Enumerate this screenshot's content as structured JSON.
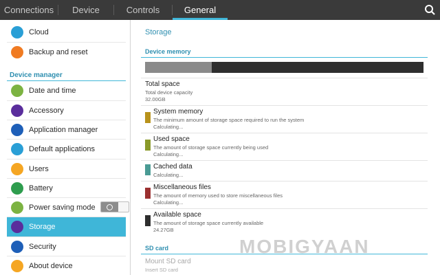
{
  "tabs": [
    {
      "label": "Connections"
    },
    {
      "label": "Device"
    },
    {
      "label": "Controls"
    },
    {
      "label": "General"
    }
  ],
  "search_icon": "search-icon",
  "sidebar": {
    "section_header": "Device manager",
    "items": [
      {
        "label": "Cloud",
        "icon": "cloud-icon",
        "color": "#2a9fd6"
      },
      {
        "label": "Backup and reset",
        "icon": "backup-icon",
        "color": "#f07b22"
      },
      {
        "label": "Date and time",
        "icon": "clock-icon",
        "color": "#7cb342"
      },
      {
        "label": "Accessory",
        "icon": "accessory-icon",
        "color": "#5a2d9c"
      },
      {
        "label": "Application manager",
        "icon": "grid-icon",
        "color": "#1e5fb8"
      },
      {
        "label": "Default applications",
        "icon": "apps-icon",
        "color": "#2a9fd6"
      },
      {
        "label": "Users",
        "icon": "user-icon",
        "color": "#f5a623"
      },
      {
        "label": "Battery",
        "icon": "battery-icon",
        "color": "#2e9d4e"
      },
      {
        "label": "Power saving mode",
        "icon": "leaf-icon",
        "color": "#7cb342"
      },
      {
        "label": "Storage",
        "icon": "storage-icon",
        "color": "#5a2d9c"
      },
      {
        "label": "Security",
        "icon": "lock-icon",
        "color": "#1e5fb8"
      },
      {
        "label": "About device",
        "icon": "info-icon",
        "color": "#f5a623"
      }
    ],
    "power_saving_enabled": false,
    "active_color": "#3fb6d8"
  },
  "content": {
    "title": "Storage",
    "device_memory": {
      "header": "Device memory",
      "used_fraction": 0.24,
      "total": {
        "title": "Total space",
        "sub": "Total device capacity",
        "value": "32.00GB"
      },
      "rows": [
        {
          "title": "System memory",
          "desc": "The minimum amount of storage space required to run the system",
          "value": "Calculating...",
          "color": "#b8921c"
        },
        {
          "title": "Used space",
          "desc": "The amount of storage space currently being used",
          "value": "Calculating...",
          "color": "#8a9a2a"
        },
        {
          "title": "Cached data",
          "desc": "",
          "value": "Calculating...",
          "color": "#4a9b94"
        },
        {
          "title": "Miscellaneous files",
          "desc": "The amount of memory used to store miscellaneous files",
          "value": "Calculating...",
          "color": "#9b3030"
        },
        {
          "title": "Available space",
          "desc": "The amount of storage space currently available",
          "value": "24.27GB",
          "color": "#2e2e2e"
        }
      ]
    },
    "sd_card": {
      "header": "SD card",
      "mount_title": "Mount SD card",
      "mount_sub": "Insert SD card"
    }
  },
  "watermark": "MOBIGYAAN"
}
